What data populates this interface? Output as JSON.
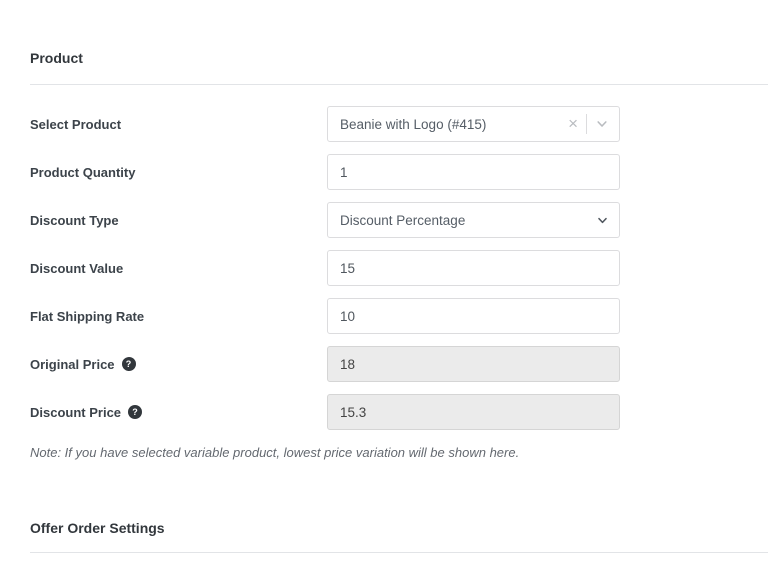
{
  "product_section": {
    "title": "Product",
    "rows": [
      {
        "label": "Select Product",
        "type": "select2",
        "value": "Beanie with Logo (#415)",
        "clear_icon": "×"
      },
      {
        "label": "Product Quantity",
        "type": "text",
        "value": "1"
      },
      {
        "label": "Discount Type",
        "type": "select",
        "value": "Discount Percentage"
      },
      {
        "label": "Discount Value",
        "type": "text",
        "value": "15"
      },
      {
        "label": "Flat Shipping Rate",
        "type": "text",
        "value": "10"
      },
      {
        "label": "Original Price",
        "type": "text-disabled",
        "value": "18",
        "help_icon": "?"
      },
      {
        "label": "Discount Price",
        "type": "text-disabled",
        "value": "15.3",
        "help_icon": "?"
      }
    ],
    "note": "Note: If you have selected variable product, lowest price variation will be shown here."
  },
  "offer_order_section": {
    "title": "Offer Order Settings"
  },
  "colors": {
    "label": "#3c434a",
    "input_border": "#dcdcde",
    "disabled_input_bg": "#ebebeb",
    "note_text": "#646970",
    "divider": "#e2e4e7",
    "help_icon_bg": "#32373c",
    "combo_icon": "#b9bcc0",
    "select_chevron": "#50575e"
  }
}
